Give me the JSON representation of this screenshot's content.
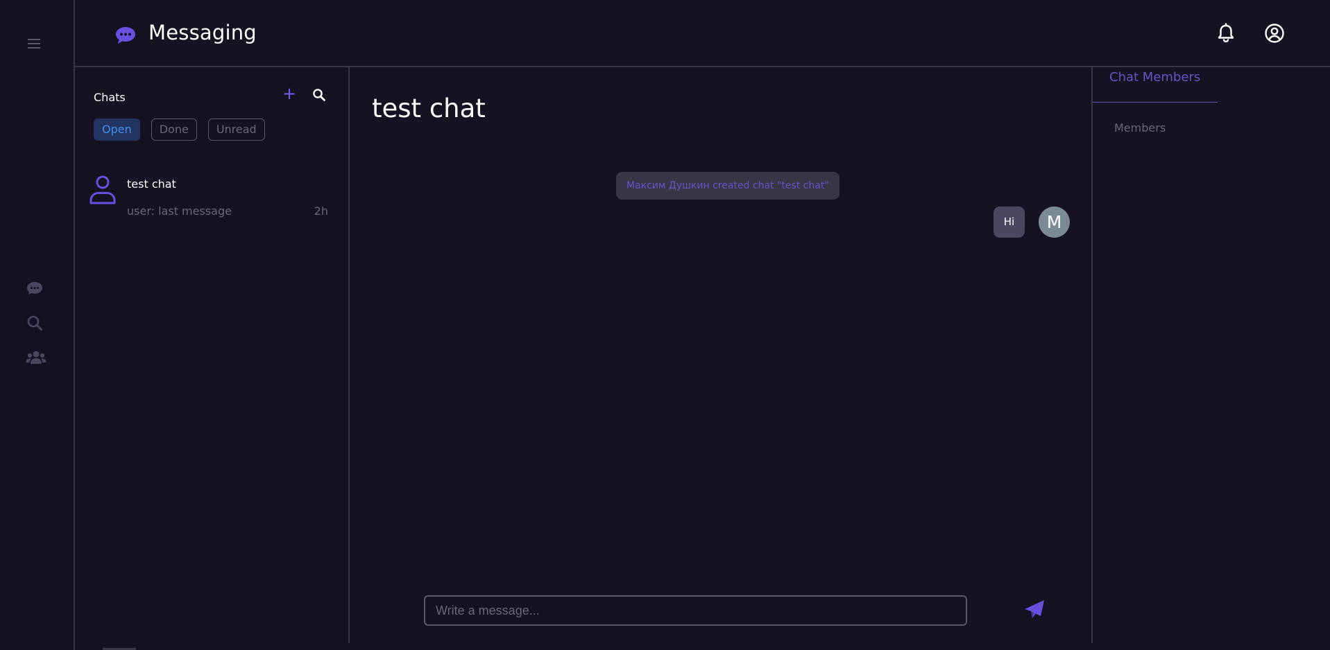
{
  "app": {
    "title": "Messaging"
  },
  "rail": {
    "menu_icon": "hamburger-menu-icon",
    "items": [
      {
        "icon": "chat-bubble-icon"
      },
      {
        "icon": "search-icon"
      },
      {
        "icon": "users-group-icon"
      }
    ]
  },
  "header": {
    "notifications_icon": "bell-icon",
    "profile_icon": "user-circle-icon"
  },
  "chats": {
    "title": "Chats",
    "add_label": "+",
    "filters": [
      "Open",
      "Done",
      "Unread"
    ],
    "active_filter": "Open",
    "items": [
      {
        "name": "test chat",
        "last_message": "user: last message",
        "time": "2h"
      }
    ]
  },
  "conversation": {
    "title": "test chat",
    "system_message": "Максим Душкин created chat \"test chat\"",
    "messages": [
      {
        "text": "Hi",
        "avatar_initial": "M"
      }
    ],
    "composer_placeholder": "Write a message..."
  },
  "members": {
    "tab_label": "Chat Members",
    "section_label": "Members"
  },
  "colors": {
    "background": "#161222",
    "accent": "#6a52c8",
    "border": "#3b3748",
    "muted_text": "#6c6778",
    "active_filter_bg": "#22345f",
    "active_filter_text": "#3f8ff0"
  }
}
